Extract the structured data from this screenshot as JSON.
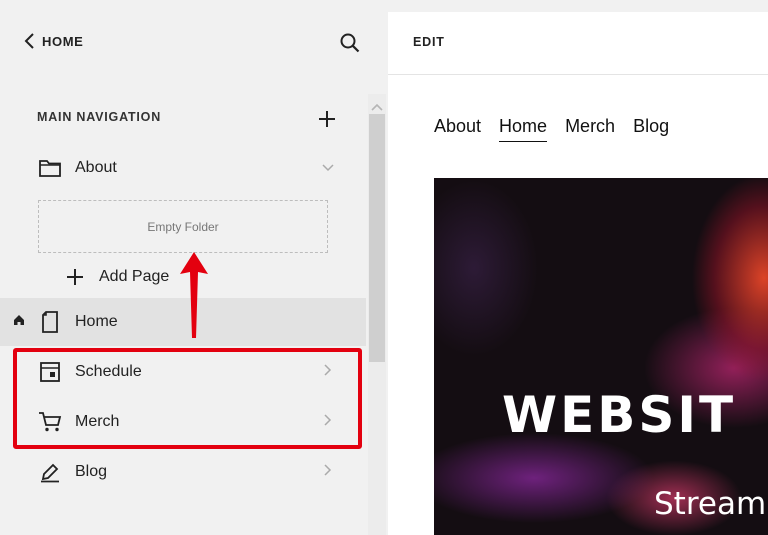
{
  "sidebar": {
    "back_label": "HOME",
    "section_title": "MAIN NAVIGATION",
    "items": [
      {
        "label": "About",
        "icon": "folder-icon"
      },
      {
        "label": "Home",
        "icon": "page-icon"
      },
      {
        "label": "Schedule",
        "icon": "calendar-page-icon"
      },
      {
        "label": "Merch",
        "icon": "cart-icon"
      },
      {
        "label": "Blog",
        "icon": "blog-icon"
      }
    ],
    "empty_folder_label": "Empty Folder",
    "add_page_label": "Add Page"
  },
  "main": {
    "edit_label": "EDIT",
    "site_nav": [
      "About",
      "Home",
      "Merch",
      "Blog"
    ],
    "active_nav": "Home",
    "hero_title": "WEBSIT",
    "hero_subtitle": "Streamin"
  },
  "colors": {
    "highlight": "#e3000f",
    "sidebar_bg": "#f1f1f1",
    "selected_row_bg": "#e2e2e2"
  }
}
